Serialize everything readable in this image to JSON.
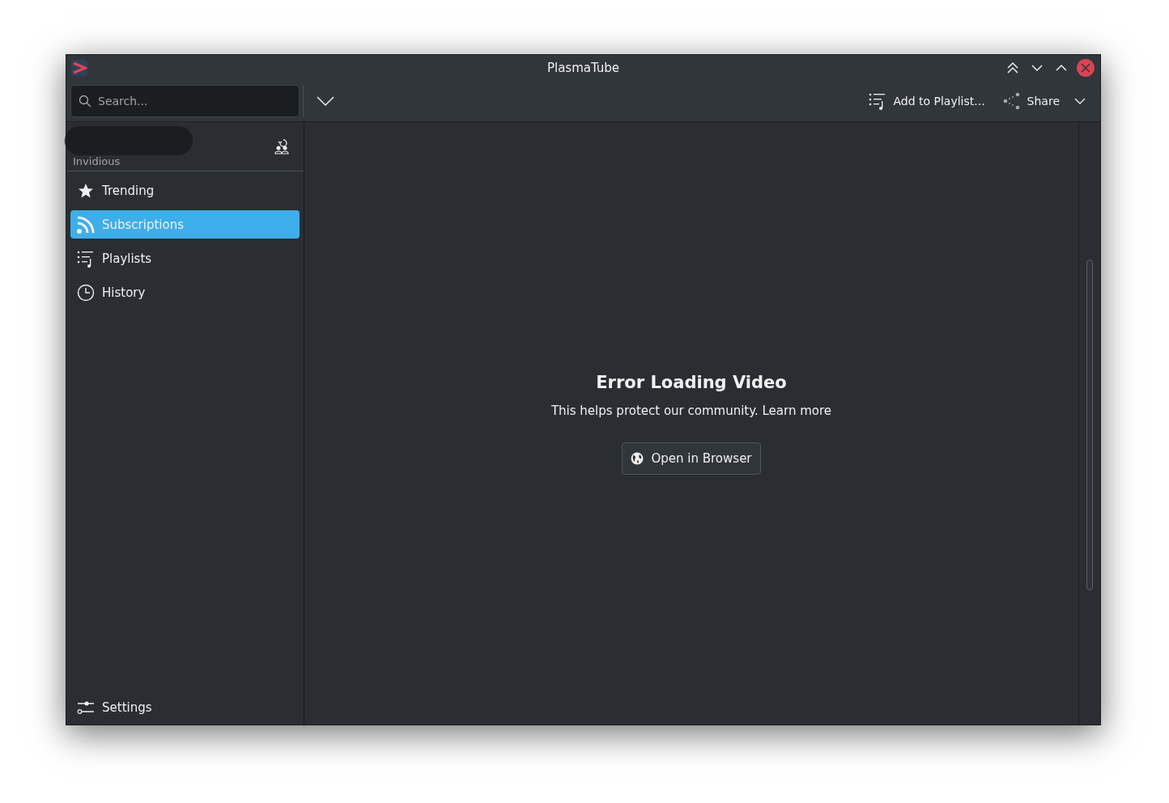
{
  "window": {
    "title": "PlasmaTube"
  },
  "toolbar": {
    "search": {
      "placeholder": "Search..."
    },
    "actions": [
      {
        "kind": "playlist",
        "label": "Add to Playlist..."
      },
      {
        "kind": "share",
        "label": "Share"
      }
    ]
  },
  "sidebar": {
    "account": {
      "label": "Invidious"
    },
    "items": [
      {
        "kind": "star",
        "label": "Trending",
        "selected": false
      },
      {
        "kind": "rss",
        "label": "Subscriptions",
        "selected": true
      },
      {
        "kind": "playlist",
        "label": "Playlists",
        "selected": false
      },
      {
        "kind": "clock",
        "label": "History",
        "selected": false
      }
    ],
    "footer": {
      "kind": "settings",
      "label": "Settings"
    }
  },
  "content": {
    "title": "Error Loading Video",
    "message": "This helps protect our community. Learn more",
    "button": "Open in Browser"
  }
}
